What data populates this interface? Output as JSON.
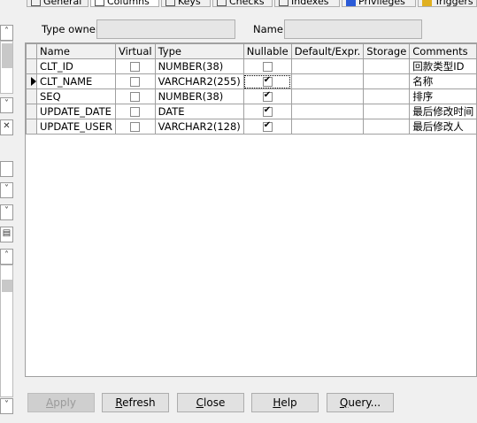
{
  "tabs": [
    {
      "label": "General",
      "icon": "general-icon"
    },
    {
      "label": "Columns",
      "icon": "columns-icon"
    },
    {
      "label": "Keys",
      "icon": "key-icon"
    },
    {
      "label": "Checks",
      "icon": "check-icon"
    },
    {
      "label": "Indexes",
      "icon": "index-icon"
    },
    {
      "label": "Privileges",
      "icon": "privileges-icon"
    },
    {
      "label": "Triggers",
      "icon": "trigger-icon"
    }
  ],
  "form": {
    "type_owner_label": "Type owner",
    "type_owner_value": "",
    "name_label": "Name",
    "name_value": ""
  },
  "grid": {
    "headers": [
      "Name",
      "Virtual",
      "Type",
      "Nullable",
      "Default/Expr.",
      "Storage",
      "Comments"
    ],
    "rows": [
      {
        "name": "CLT_ID",
        "virtual": false,
        "type": "NUMBER(38)",
        "nullable": false,
        "default": "",
        "storage": "",
        "comments": "回款类型ID",
        "current": false
      },
      {
        "name": "CLT_NAME",
        "virtual": false,
        "type": "VARCHAR2(255)",
        "nullable": true,
        "default": "",
        "storage": "",
        "comments": "名称",
        "current": true
      },
      {
        "name": "SEQ",
        "virtual": false,
        "type": "NUMBER(38)",
        "nullable": true,
        "default": "",
        "storage": "",
        "comments": "排序",
        "current": false
      },
      {
        "name": "UPDATE_DATE",
        "virtual": false,
        "type": "DATE",
        "nullable": true,
        "default": "",
        "storage": "",
        "comments": "最后修改时间",
        "current": false
      },
      {
        "name": "UPDATE_USER",
        "virtual": false,
        "type": "VARCHAR2(128)",
        "nullable": true,
        "default": "",
        "storage": "",
        "comments": "最后修改人",
        "current": false
      }
    ]
  },
  "buttons": {
    "apply": {
      "prefix": "",
      "u": "A",
      "rest": "pply",
      "enabled": false
    },
    "refresh": {
      "prefix": "",
      "u": "R",
      "rest": "efresh",
      "enabled": true
    },
    "close": {
      "prefix": "",
      "u": "C",
      "rest": "lose",
      "enabled": true
    },
    "help": {
      "prefix": "",
      "u": "H",
      "rest": "elp",
      "enabled": true
    },
    "query": {
      "prefix": "",
      "u": "Q",
      "rest": "uery...",
      "enabled": true
    }
  }
}
